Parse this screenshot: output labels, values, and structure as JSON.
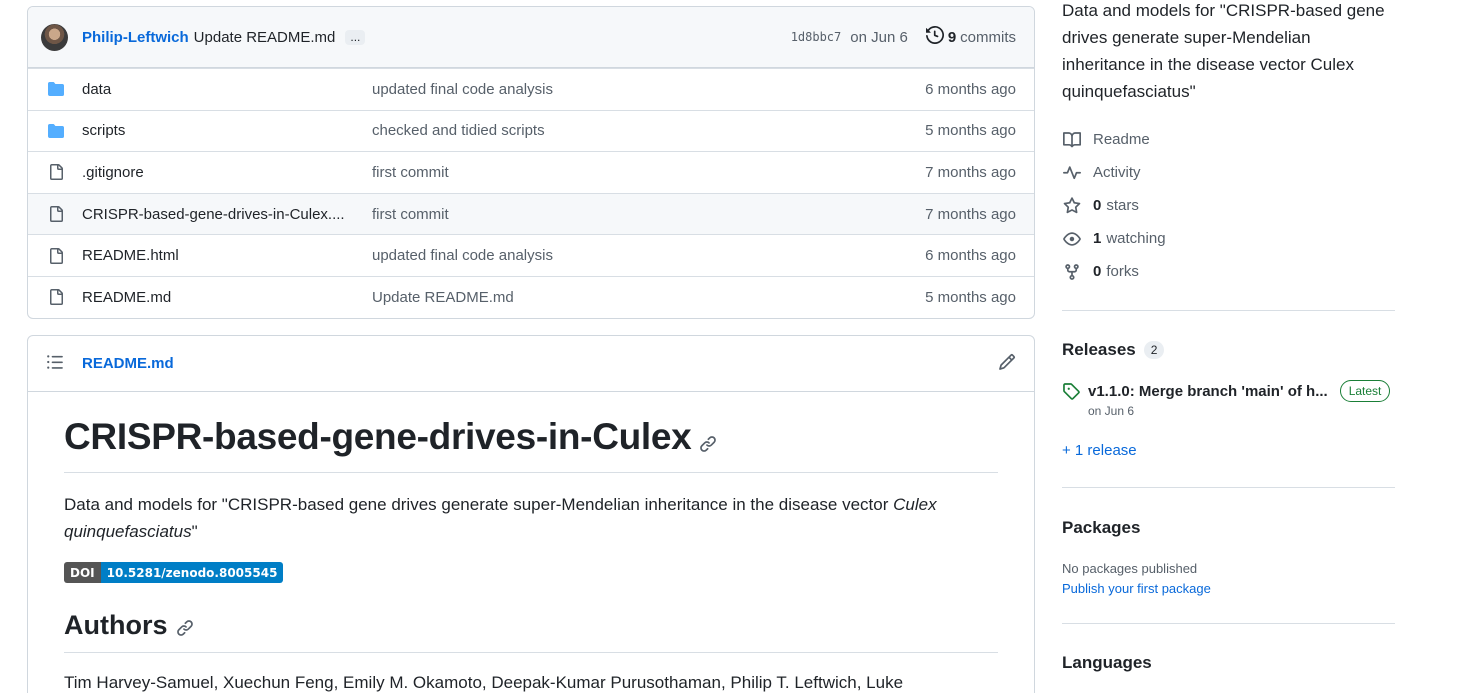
{
  "commit_bar": {
    "author": "Philip-Leftwich",
    "message": "Update README.md",
    "ellipsis": "...",
    "sha": "1d8bbc7",
    "date": "on Jun 6",
    "commits_count": "9",
    "commits_label": "commits"
  },
  "files": [
    {
      "type": "folder",
      "name": "data",
      "message": "updated final code analysis",
      "date": "6 months ago"
    },
    {
      "type": "folder",
      "name": "scripts",
      "message": "checked and tidied scripts",
      "date": "5 months ago"
    },
    {
      "type": "file",
      "name": ".gitignore",
      "message": "first commit",
      "date": "7 months ago"
    },
    {
      "type": "file",
      "name": "CRISPR-based-gene-drives-in-Culex....",
      "message": "first commit",
      "date": "7 months ago"
    },
    {
      "type": "file",
      "name": "README.html",
      "message": "updated final code analysis",
      "date": "6 months ago"
    },
    {
      "type": "file",
      "name": "README.md",
      "message": "Update README.md",
      "date": "5 months ago"
    }
  ],
  "readme": {
    "file_label": "README.md",
    "h1": "CRISPR-based-gene-drives-in-Culex",
    "desc_prefix": "Data and models for \"CRISPR-based gene drives generate super-Mendelian inheritance in the disease vector ",
    "desc_italic": "Culex quinquefasciatus",
    "desc_suffix": "\"",
    "badge_left": "DOI",
    "badge_right": "10.5281/zenodo.8005545",
    "h2": "Authors",
    "authors": "Tim Harvey-Samuel, Xuechun Feng, Emily M. Okamoto, Deepak-Kumar Purusothaman, Philip T. Leftwich, Luke"
  },
  "sidebar": {
    "about": "Data and models for \"CRISPR-based gene drives generate super-Mendelian inheritance in the disease vector Culex quinquefasciatus\"",
    "readme": "Readme",
    "activity": "Activity",
    "stars_count": "0",
    "stars_label": "stars",
    "watching_count": "1",
    "watching_label": "watching",
    "forks_count": "0",
    "forks_label": "forks",
    "releases_title": "Releases",
    "releases_count": "2",
    "release_name": "v1.1.0: Merge branch 'main' of h...",
    "release_badge": "Latest",
    "release_date": "on Jun 6",
    "more_releases": "+ 1 release",
    "packages_title": "Packages",
    "packages_text": "No packages published",
    "packages_link": "Publish your first package",
    "languages_title": "Languages"
  },
  "colors": {
    "accent": "#0969da",
    "folder": "#54aeff",
    "latest": "#1a7f37",
    "badge_doi": "#007ec6"
  }
}
